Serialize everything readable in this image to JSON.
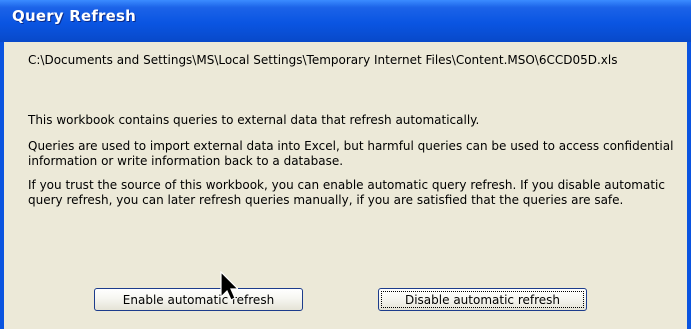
{
  "window": {
    "title": "Query Refresh"
  },
  "content": {
    "file_path": "C:\\Documents and Settings\\MS\\Local Settings\\Temporary Internet Files\\Content.MSO\\6CCD05D.xls",
    "message_1": "This workbook contains queries to external data that refresh automatically.",
    "message_2": "Queries are used to import external data into Excel, but harmful queries can be used to access confidential information or write information back to a database.",
    "message_3": "If you trust the source of this workbook, you can enable automatic query refresh. If you disable automatic query refresh, you can later refresh queries manually, if you are satisfied that the queries are safe."
  },
  "buttons": {
    "enable_label": "Enable automatic refresh",
    "disable_label": "Disable automatic refresh"
  },
  "colors": {
    "titlebar": "#0a55e2",
    "client_background": "#ece9d8"
  },
  "icons": {
    "cursor": "mouse-pointer-icon"
  }
}
